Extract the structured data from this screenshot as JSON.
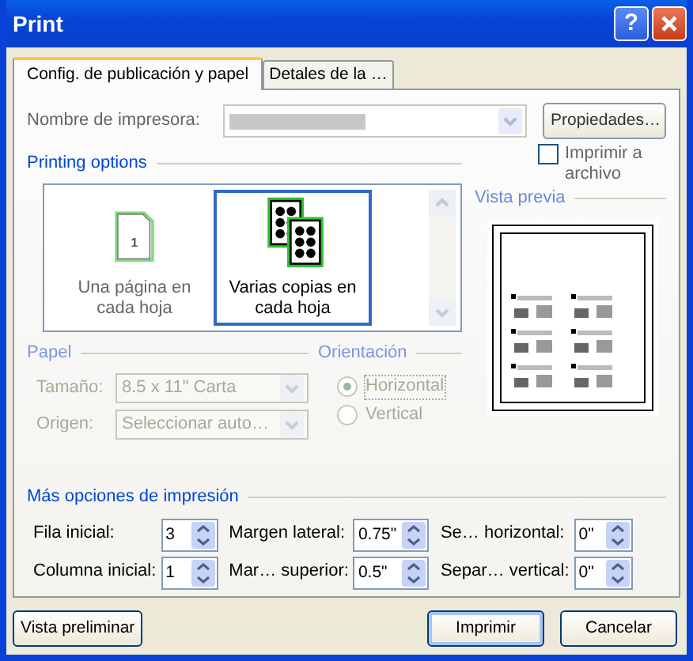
{
  "window": {
    "title": "Print",
    "help_button": "?"
  },
  "tabs": [
    {
      "label": "Config. de publicación y papel",
      "selected": true
    },
    {
      "label": "Detales de la …",
      "selected": false
    }
  ],
  "printer": {
    "label": "Nombre de impresora:",
    "properties_button": "Propiedades…"
  },
  "print_to_file": {
    "label": "Imprimir a archivo",
    "checked": false
  },
  "printing_options": {
    "title": "Printing options",
    "items": [
      {
        "label": "Una página en cada hoja",
        "kind": "single",
        "icon_label": "1",
        "selected": false
      },
      {
        "label": "Varias copias en cada hoja",
        "kind": "multiple",
        "selected": true
      }
    ]
  },
  "preview": {
    "title": "Vista previa"
  },
  "paper": {
    "title": "Papel",
    "disabled": true,
    "fields": [
      {
        "label": "Tamaño:",
        "value": "8.5 x 11\" Carta"
      },
      {
        "label": "Origen:",
        "value": "Seleccionar auto…"
      }
    ]
  },
  "orientation": {
    "title": "Orientación",
    "disabled": true,
    "options": [
      {
        "label": "Horizontal",
        "selected": true
      },
      {
        "label": "Vertical",
        "selected": false
      }
    ]
  },
  "more_options": {
    "title": "Más opciones de impresión",
    "fields": [
      {
        "label": "Fila inicial:",
        "value": "3"
      },
      {
        "label": "Margen lateral:",
        "value": "0.75\""
      },
      {
        "label": "Se… horizontal:",
        "value": "0\""
      },
      {
        "label": "Columna inicial:",
        "value": "1"
      },
      {
        "label": "Mar… superior:",
        "value": "0.5\""
      },
      {
        "label": "Separ… vertical:",
        "value": "0\""
      }
    ]
  },
  "buttons": [
    {
      "label": "Vista preliminar",
      "default": false
    },
    {
      "label": "Imprimir",
      "default": true
    },
    {
      "label": "Cancelar",
      "default": false
    }
  ]
}
